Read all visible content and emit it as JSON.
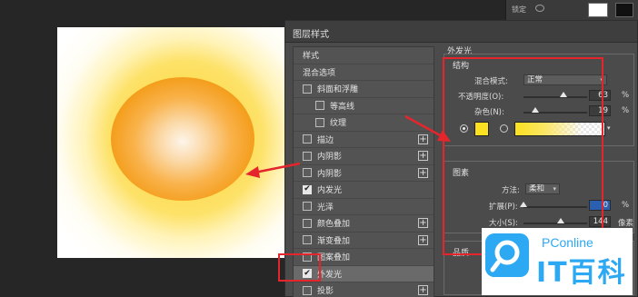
{
  "dialog": {
    "title": "图层样式"
  },
  "left_panel": {
    "header": "样式",
    "items": [
      {
        "label": "混合选项",
        "checkbox": false,
        "indent": false,
        "checked": false,
        "plus": false
      },
      {
        "label": "斜面和浮雕",
        "checkbox": true,
        "indent": false,
        "checked": false,
        "plus": false
      },
      {
        "label": "等高线",
        "checkbox": true,
        "indent": true,
        "checked": false,
        "plus": false
      },
      {
        "label": "纹理",
        "checkbox": true,
        "indent": true,
        "checked": false,
        "plus": false
      },
      {
        "label": "描边",
        "checkbox": true,
        "indent": false,
        "checked": false,
        "plus": true
      },
      {
        "label": "内阴影",
        "checkbox": true,
        "indent": false,
        "checked": false,
        "plus": true
      },
      {
        "label": "内阴影",
        "checkbox": true,
        "indent": false,
        "checked": false,
        "plus": true
      },
      {
        "label": "内发光",
        "checkbox": true,
        "indent": false,
        "checked": true,
        "plus": false
      },
      {
        "label": "光泽",
        "checkbox": true,
        "indent": false,
        "checked": false,
        "plus": false
      },
      {
        "label": "颜色叠加",
        "checkbox": true,
        "indent": false,
        "checked": false,
        "plus": true
      },
      {
        "label": "渐变叠加",
        "checkbox": true,
        "indent": false,
        "checked": false,
        "plus": true
      },
      {
        "label": "图案叠加",
        "checkbox": true,
        "indent": false,
        "checked": false,
        "plus": false
      },
      {
        "label": "外发光",
        "checkbox": true,
        "indent": false,
        "checked": true,
        "plus": false
      },
      {
        "label": "投影",
        "checkbox": true,
        "indent": false,
        "checked": false,
        "plus": true
      }
    ]
  },
  "outer_glow": {
    "title": "外发光",
    "structure": {
      "title": "结构",
      "blend_mode_label": "混合模式:",
      "blend_mode_value": "正常",
      "opacity_label": "不透明度(O):",
      "opacity_value": "63",
      "opacity_unit": "%",
      "noise_label": "杂色(N):",
      "noise_value": "19",
      "noise_unit": "%",
      "glow_color": "#fbe11f"
    },
    "elements": {
      "title": "图素",
      "technique_label": "方法:",
      "technique_value": "柔和",
      "spread_label": "扩展(P):",
      "spread_value": "0",
      "spread_unit": "%",
      "size_label": "大小(S):",
      "size_value": "144",
      "size_unit": "像素"
    },
    "quality": {
      "title": "品质"
    }
  },
  "layers_strip": {
    "label": "锁定"
  },
  "logo": {
    "brand": "PConline",
    "cn": "IT百科"
  },
  "levels": {
    "opacity": 0.63,
    "noise": 0.19,
    "spread": 0.0,
    "size": 0.58
  },
  "colors": {
    "annotation_red": "#e4262c",
    "glow_yellow": "#fbe11f",
    "sun_orange": "#f39a16",
    "logo_blue": "#2da8f2"
  }
}
